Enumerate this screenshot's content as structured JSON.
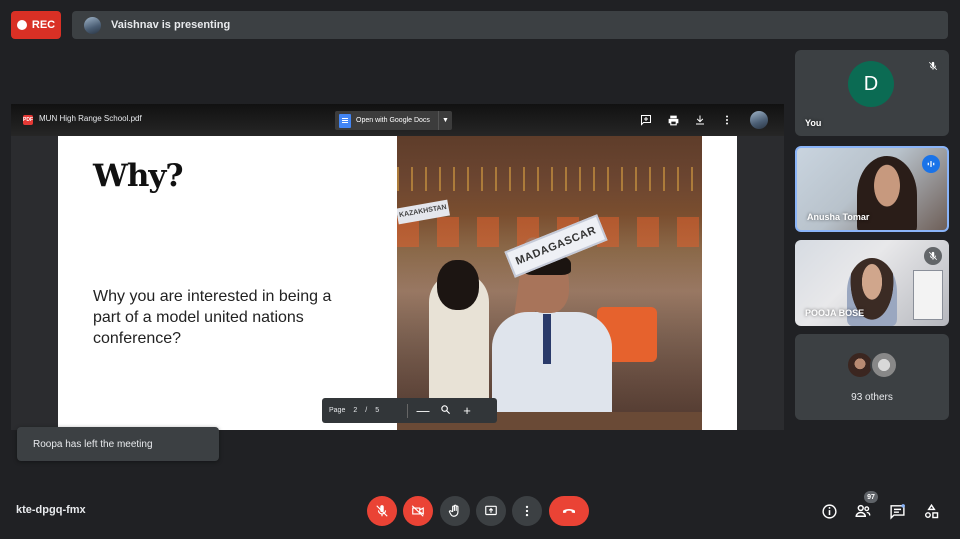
{
  "recording": {
    "label": "REC",
    "color": "#d93025"
  },
  "presenting_bar": {
    "text": "Vaishnav is presenting"
  },
  "viewer": {
    "file_name": "MUN High Range School.pdf",
    "pdf_badge": "PDF",
    "open_with": "Open with Google Docs",
    "icons": [
      "add-comment-icon",
      "print-icon",
      "download-icon",
      "more-vert-icon"
    ]
  },
  "slide": {
    "heading": "Why?",
    "question": "Why you are interested in being a part of a model united nations conference?",
    "placard_main": "MADAGASCAR",
    "placard_side": "KAZAKHSTAN"
  },
  "pagination": {
    "label": "Page",
    "current": "2",
    "separator": "/",
    "total": "5",
    "zoom_out": "—",
    "zoom_in": "+"
  },
  "participants": [
    {
      "name": "You",
      "initial": "D",
      "avatar_color": "#0b6b53",
      "mic": "off"
    },
    {
      "name": "Anusha Tomar",
      "mic": "speaking"
    },
    {
      "name": "POOJA BOSE",
      "mic": "off"
    }
  ],
  "others": {
    "label": "93 others"
  },
  "toast": {
    "text": "Roopa has left the meeting"
  },
  "meeting_code": "kte-dpgq-fmx",
  "controls": {
    "mic": "mic-off-icon",
    "camera": "videocam-off-icon",
    "raise_hand": "hand-icon",
    "present": "present-screen-icon",
    "more": "more-vert-icon",
    "leave": "call-end-icon",
    "danger_color": "#ea4335"
  },
  "right_controls": {
    "people_count": "97"
  }
}
